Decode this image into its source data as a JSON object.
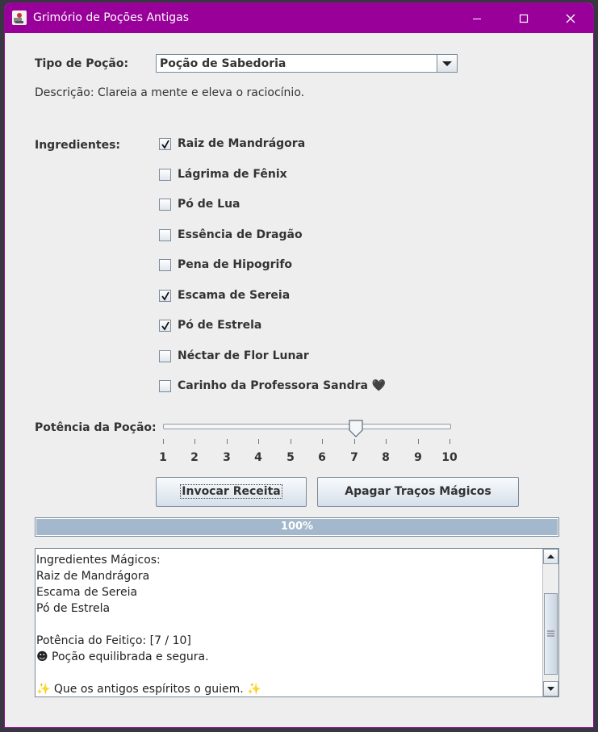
{
  "window": {
    "title": "Grimório de Poções Antigas",
    "accent": "#990099"
  },
  "form": {
    "potion_type_label": "Tipo de Poção:",
    "potion_type_selected": "Poção de Sabedoria",
    "description": "Descrição: Clareia a mente e eleva o raciocínio.",
    "ingredients_label": "Ingredientes:",
    "ingredients": [
      {
        "label": "Raiz de Mandrágora",
        "checked": true
      },
      {
        "label": "Lágrima de Fênix",
        "checked": false
      },
      {
        "label": "Pó de Lua",
        "checked": false
      },
      {
        "label": "Essência de Dragão",
        "checked": false
      },
      {
        "label": "Pena de Hipogrifo",
        "checked": false
      },
      {
        "label": "Escama de Sereia",
        "checked": true
      },
      {
        "label": "Pó de Estrela",
        "checked": true
      },
      {
        "label": "Néctar de Flor Lunar",
        "checked": false
      },
      {
        "label": "Carinho da Professora Sandra 🖤",
        "checked": false
      }
    ],
    "potency_label": "Potência da Poção:",
    "potency_value": 7,
    "potency_ticks": [
      "1",
      "2",
      "3",
      "4",
      "5",
      "6",
      "7",
      "8",
      "9",
      "10"
    ]
  },
  "buttons": {
    "invoke": "Invocar Receita",
    "erase": "Apagar Traços Mágicos"
  },
  "progress": {
    "value": 100,
    "label": "100%"
  },
  "output": {
    "lines": [
      "Ingredientes Mágicos:",
      "Raiz de Mandrágora",
      "Escama de Sereia",
      "Pó de Estrela",
      "",
      "Potência do Feitiço: [7 / 10]",
      "☻ Poção equilibrada e segura.",
      "",
      "✨ Que os antigos espíritos o guiem. ✨"
    ]
  }
}
